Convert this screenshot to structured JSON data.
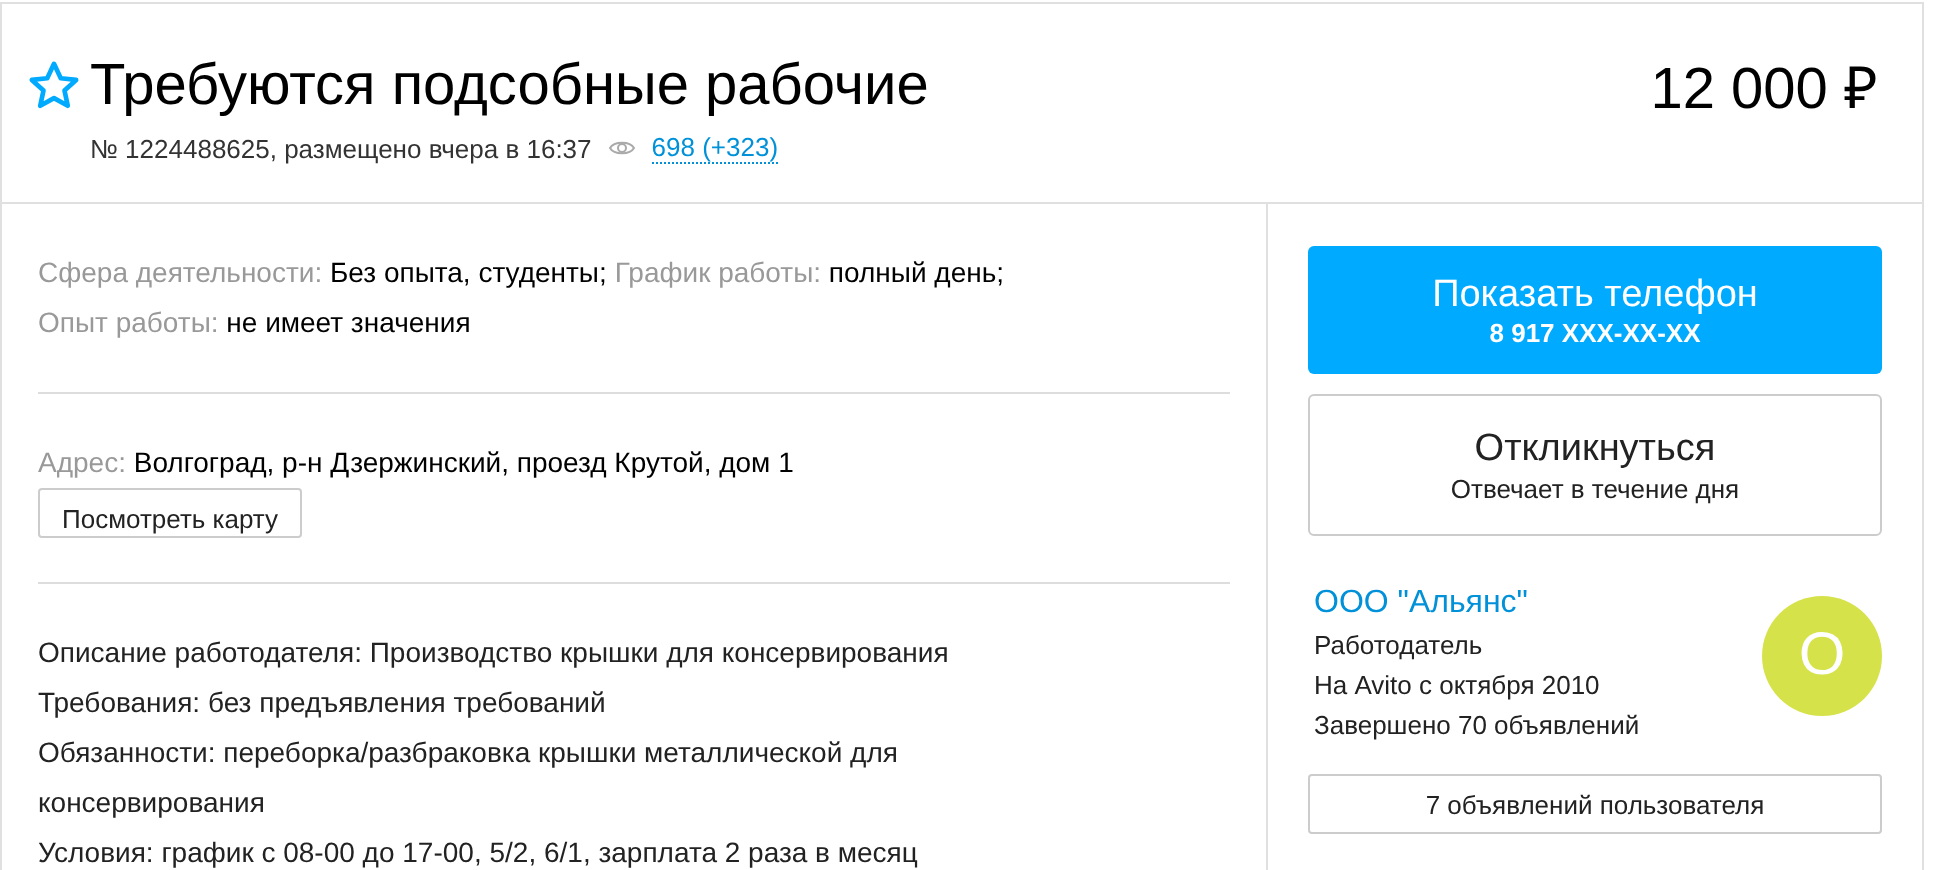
{
  "header": {
    "favorite": false,
    "title": "Требуются подсобные рабочие",
    "meta": "№ 1224488625, размещено вчера в 16:37",
    "views": "698 (+323)",
    "price": "12 000 ₽"
  },
  "attributes": [
    {
      "label": "Сфера деятельности:",
      "value": "Без опыта, студенты;"
    },
    {
      "label": "График работы:",
      "value": "полный день;"
    },
    {
      "label": "Опыт работы:",
      "value": "не имеет значения"
    }
  ],
  "address": {
    "label": "Адрес:",
    "value": "Волгоград, р-н Дзержинский, проезд Крутой, дом 1",
    "map_button": "Посмотреть карту"
  },
  "description": [
    "Описание работодателя: Производство крышки для консервирования",
    "Требования: без предъявления требований",
    "Обязанности: переборка/разбраковка крышки металлической для консервирования",
    "Условия: график с 08-00 до 17-00, 5/2, 6/1, зарплата 2 раза в месяц"
  ],
  "sidebar": {
    "phone_button": {
      "label": "Показать телефон",
      "number": "8 917 XXX-XX-XX"
    },
    "reply_button": {
      "label": "Откликнуться",
      "note": "Отвечает в течение дня"
    },
    "seller": {
      "name": "ООО \"Альянс\"",
      "lines": [
        "Работодатель",
        "На Avito с октября 2010",
        "Завершено 70 объявлений"
      ],
      "avatar_letter": "О",
      "color": "#d6e24a"
    },
    "listings_button": "7 объявлений пользователя"
  }
}
